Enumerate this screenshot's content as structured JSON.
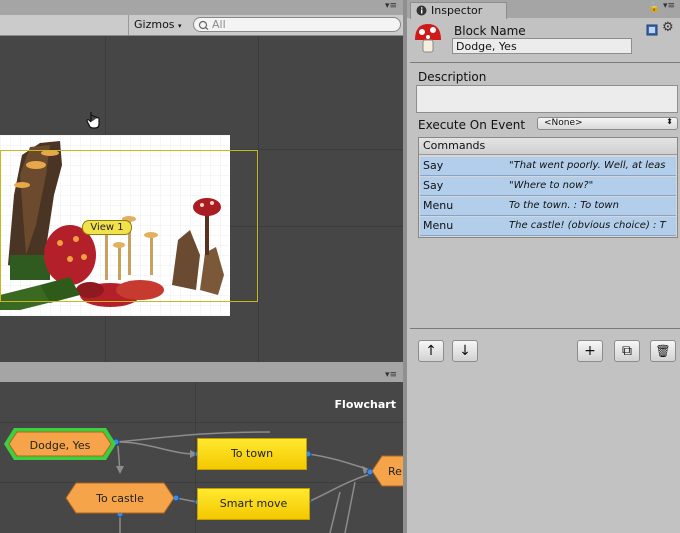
{
  "scene": {
    "gizmos_label": "Gizmos",
    "search_placeholder": "All",
    "view_label": "View 1"
  },
  "flowchart": {
    "title": "Flowchart",
    "blocks": [
      {
        "label": "Dodge, Yes",
        "shape": "hexagon",
        "color": "#f5a44a",
        "selected": true
      },
      {
        "label": "To town",
        "shape": "rect",
        "color": "#f7d51a"
      },
      {
        "label": "To castle",
        "shape": "hexagon",
        "color": "#f5a44a"
      },
      {
        "label": "Smart move",
        "shape": "rect",
        "color": "#f7d51a"
      },
      {
        "label": "Re",
        "shape": "hexagon",
        "color": "#f5a44a"
      }
    ]
  },
  "inspector": {
    "tab_label": "Inspector",
    "block_name_label": "Block Name",
    "block_name_value": "Dodge, Yes",
    "description_label": "Description",
    "description_value": "",
    "execute_label": "Execute On Event",
    "execute_value": "<None>",
    "commands_header": "Commands",
    "commands": [
      {
        "name": "Say",
        "text": "\"That went poorly. Well, at leas"
      },
      {
        "name": "Say",
        "text": "\"Where to now?\""
      },
      {
        "name": "Menu",
        "text": "To the town. : To town"
      },
      {
        "name": "Menu",
        "text": "The castle! (obvious choice) : T"
      }
    ],
    "buttons": {
      "up": "↑",
      "down": "↓",
      "add": "+",
      "duplicate": "⧉",
      "delete": "🗑"
    }
  },
  "colors": {
    "selected_outline": "#3ecf3e",
    "command_row": "#b3ceea",
    "camera_rect": "#c8b820"
  }
}
